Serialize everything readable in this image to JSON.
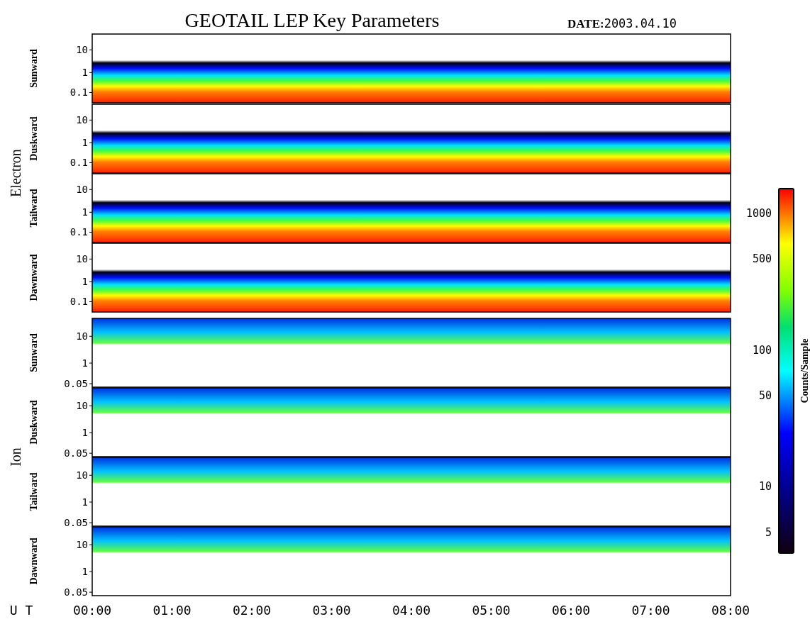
{
  "title": "GEOTAIL LEP Key Parameters",
  "date_label": "DATE:",
  "date": "2003.04.10",
  "groups": [
    {
      "kind": "electron",
      "label": "Electron",
      "panels": [
        {
          "direction": "Sunward",
          "yticks": [
            "10",
            "1",
            "0.1"
          ]
        },
        {
          "direction": "Duskward",
          "yticks": [
            "10",
            "1",
            "0.1"
          ]
        },
        {
          "direction": "Tailward",
          "yticks": [
            "10",
            "1",
            "0.1"
          ]
        },
        {
          "direction": "Dawnward",
          "yticks": [
            "10",
            "1",
            "0.1"
          ]
        }
      ]
    },
    {
      "kind": "ion",
      "label": "Ion",
      "panels": [
        {
          "direction": "Sunward",
          "yticks": [
            "10",
            "1",
            "0.05"
          ]
        },
        {
          "direction": "Duskward",
          "yticks": [
            "10",
            "1",
            "0.05"
          ]
        },
        {
          "direction": "Tailward",
          "yticks": [
            "10",
            "1",
            "0.05"
          ]
        },
        {
          "direction": "Dawnward",
          "yticks": [
            "10",
            "1",
            "0.05"
          ]
        }
      ]
    }
  ],
  "time_axis": {
    "label": "U T",
    "ticks": [
      "00:00",
      "01:00",
      "02:00",
      "03:00",
      "04:00",
      "05:00",
      "06:00",
      "07:00",
      "08:00"
    ]
  },
  "colorbar": {
    "label": "Counts/Sample",
    "ticks": [
      "1000",
      "500",
      "100",
      "50",
      "10",
      "5"
    ]
  }
}
